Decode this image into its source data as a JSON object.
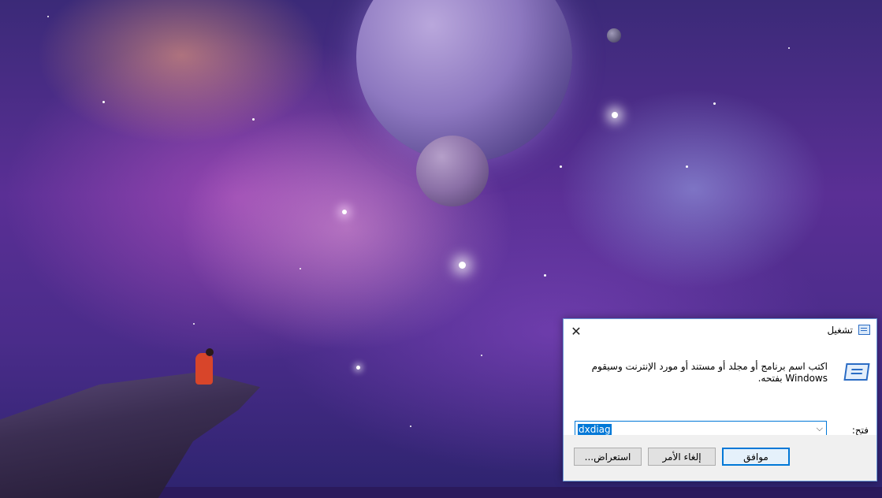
{
  "dialog": {
    "title": "تشغيل",
    "description": "اكتب اسم برنامج أو مجلد أو مستند أو مورد الإنترنت وسيقوم Windows بفتحه.",
    "open_label": "فتح:",
    "input_value": "dxdiag",
    "buttons": {
      "ok": "موافق",
      "cancel": "إلغاء الأمر",
      "browse": "استعراض..."
    },
    "icons": {
      "title_icon": "run-icon",
      "large_icon": "run-icon",
      "close": "close-icon",
      "dropdown": "chevron-down-icon"
    },
    "accent_color": "#0078d7"
  }
}
